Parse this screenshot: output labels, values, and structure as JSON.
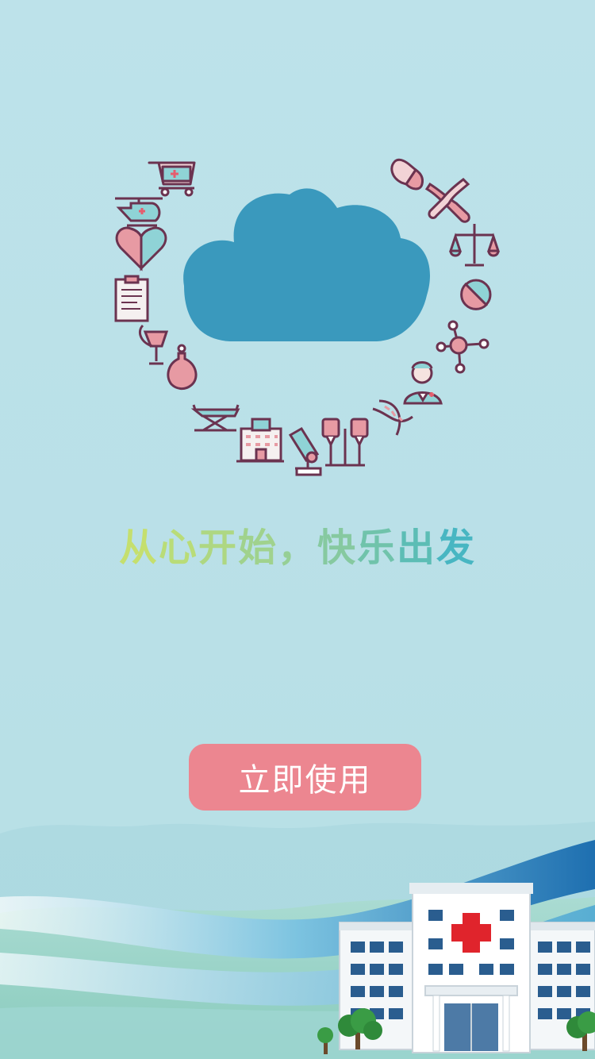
{
  "splash": {
    "logo_icon": "cloud-icon",
    "medical_icons": [
      "shopping-cart-icon",
      "helicopter-icon",
      "heart-icon",
      "clipboard-icon",
      "medicine-cup-icon",
      "flask-icon",
      "stretcher-icon",
      "hospital-building-icon",
      "microscope-icon",
      "iv-drip-icon",
      "dna-icon",
      "doctor-icon",
      "molecule-icon",
      "pill-tablet-icon",
      "scales-icon",
      "chromosome-icon",
      "capsule-icon"
    ],
    "slogan": [
      {
        "char": "从",
        "color": "#c5df6e"
      },
      {
        "char": "心",
        "color": "#b9dc78"
      },
      {
        "char": "开",
        "color": "#aed782"
      },
      {
        "char": "始",
        "color": "#a0d28d"
      },
      {
        "char": "，",
        "color": "#96cf95"
      },
      {
        "char": "快",
        "color": "#86c9a0"
      },
      {
        "char": "乐",
        "color": "#70c3ab"
      },
      {
        "char": "出",
        "color": "#5cbdb5"
      },
      {
        "char": "发",
        "color": "#48b6c2"
      }
    ],
    "start_button_label": "立即使用",
    "colors": {
      "background": "#b9e1e8",
      "cloud": "#3a99bd",
      "button": "#ec8690",
      "icon_stroke": "#6b3350",
      "icon_pink": "#e79aa3",
      "icon_teal": "#8fd3d6"
    }
  }
}
